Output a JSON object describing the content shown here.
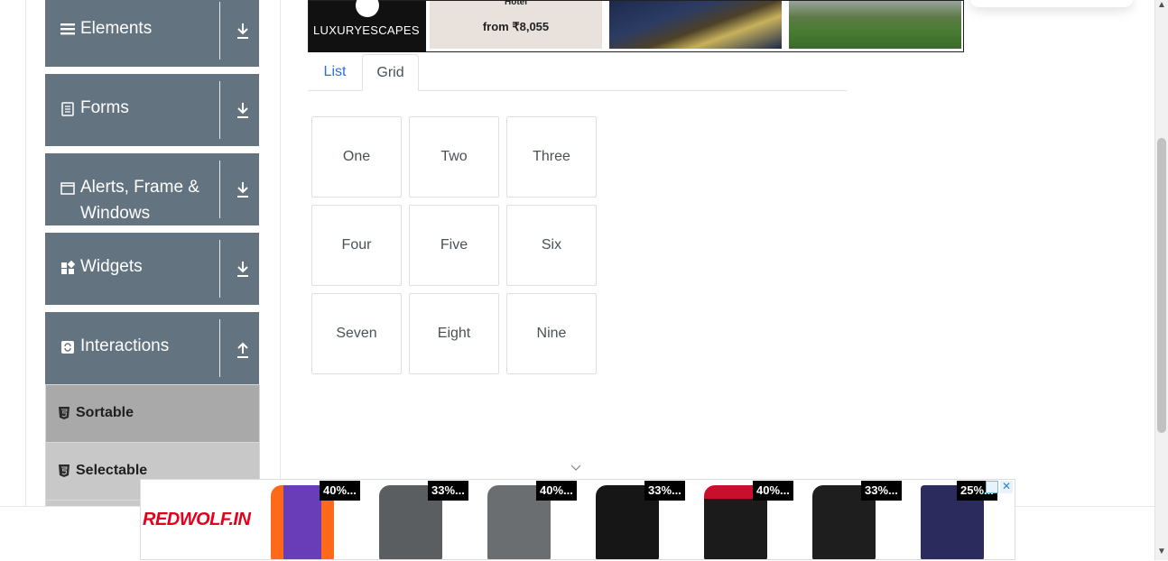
{
  "sidebar": {
    "groups": [
      {
        "label": "Elements",
        "icon": "hamburger-icon",
        "expanded": false
      },
      {
        "label": "Forms",
        "icon": "document-icon",
        "expanded": false
      },
      {
        "label": "Alerts, Frame &",
        "label2": "Windows",
        "icon": "window-icon",
        "expanded": false
      },
      {
        "label": "Widgets",
        "icon": "widgets-icon",
        "expanded": false
      },
      {
        "label": "Interactions",
        "icon": "refresh-icon",
        "expanded": true
      }
    ],
    "items": [
      {
        "label": "Sortable",
        "icon": "html5-icon",
        "active": true
      },
      {
        "label": "Selectable",
        "icon": "html5-icon",
        "active": false
      }
    ]
  },
  "banner": {
    "brand": "LUXURYESCAPES",
    "hotel_text": "Hotel",
    "price": "from ₹8,055"
  },
  "tabs": [
    {
      "label": "List",
      "active": false
    },
    {
      "label": "Grid",
      "active": true
    }
  ],
  "grid": {
    "items": [
      "One",
      "Two",
      "Three",
      "Four",
      "Five",
      "Six",
      "Seven",
      "Eight",
      "Nine"
    ]
  },
  "bottom_ad": {
    "brand": "REDWOLF.IN",
    "products": [
      {
        "discount": "40%...",
        "color": "#6a3db8"
      },
      {
        "discount": "33%...",
        "color": "#5a5e60"
      },
      {
        "discount": "40%...",
        "color": "#6a6e70"
      },
      {
        "discount": "33%...",
        "color": "#161616"
      },
      {
        "discount": "40%...",
        "color": "#1b1b1b"
      },
      {
        "discount": "33%...",
        "color": "#1e1e1e"
      },
      {
        "discount": "25%...",
        "color": "#2b2b5e"
      }
    ]
  },
  "colors": {
    "sidebar_bg": "#637480",
    "sortable_bg": "#a9a9a9",
    "selectable_bg": "#c8c8c8",
    "link_blue": "#2f6fd6"
  }
}
